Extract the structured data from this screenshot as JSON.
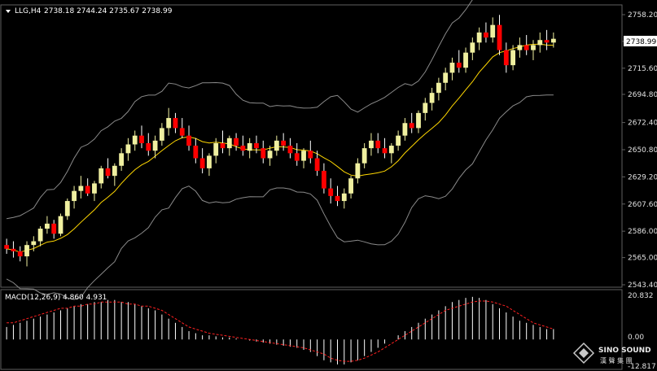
{
  "header": {
    "symbol": "LLG,H4",
    "ohlc": "2738.18 2744.24 2735.67 2738.99"
  },
  "current_price": "2738.99",
  "macd_header": {
    "label": "MACD(12,26,9)",
    "values": "4.860 4.931"
  },
  "macd_axis": {
    "top": "20.832",
    "zero": "0.00",
    "bottom": "-12.817"
  },
  "watermark": {
    "brand": "SINO SOUND",
    "cn": "漢 聲 集 團"
  },
  "colors": {
    "background": "#000000",
    "bull": "#f0f0a0",
    "bear": "#ff0000",
    "bands": "#8a8a8a",
    "ma": "#ffd700",
    "signal": "#ff2020",
    "hist": "#ffffff",
    "grid": "#606060"
  },
  "chart_data": {
    "type": "line",
    "price_ticks": [
      "2758.20",
      "2736.99",
      "2715.60",
      "2694.80",
      "2672.40",
      "2650.80",
      "2629.20",
      "2607.60",
      "2586.00",
      "2565.00",
      "2543.40"
    ],
    "price_range": [
      2543.4,
      2758.2
    ],
    "macd_range": [
      -12.817,
      20.832
    ],
    "candles": [
      [
        2575,
        2580,
        2568,
        2572
      ],
      [
        2572,
        2578,
        2565,
        2570
      ],
      [
        2570,
        2574,
        2562,
        2566
      ],
      [
        2566,
        2578,
        2558,
        2575
      ],
      [
        2575,
        2582,
        2570,
        2578
      ],
      [
        2578,
        2590,
        2574,
        2588
      ],
      [
        2588,
        2598,
        2584,
        2592
      ],
      [
        2592,
        2595,
        2580,
        2584
      ],
      [
        2584,
        2600,
        2582,
        2598
      ],
      [
        2598,
        2612,
        2595,
        2610
      ],
      [
        2610,
        2622,
        2604,
        2618
      ],
      [
        2618,
        2630,
        2612,
        2622
      ],
      [
        2622,
        2628,
        2614,
        2616
      ],
      [
        2616,
        2626,
        2610,
        2624
      ],
      [
        2624,
        2638,
        2620,
        2636
      ],
      [
        2636,
        2644,
        2628,
        2630
      ],
      [
        2630,
        2640,
        2622,
        2638
      ],
      [
        2638,
        2652,
        2634,
        2648
      ],
      [
        2648,
        2660,
        2642,
        2655
      ],
      [
        2655,
        2666,
        2650,
        2662
      ],
      [
        2662,
        2670,
        2652,
        2656
      ],
      [
        2656,
        2664,
        2646,
        2650
      ],
      [
        2650,
        2662,
        2644,
        2658
      ],
      [
        2658,
        2672,
        2654,
        2668
      ],
      [
        2668,
        2684,
        2662,
        2676
      ],
      [
        2676,
        2680,
        2664,
        2668
      ],
      [
        2668,
        2676,
        2660,
        2662
      ],
      [
        2662,
        2670,
        2650,
        2654
      ],
      [
        2654,
        2660,
        2640,
        2644
      ],
      [
        2644,
        2652,
        2632,
        2636
      ],
      [
        2636,
        2648,
        2630,
        2646
      ],
      [
        2646,
        2660,
        2640,
        2656
      ],
      [
        2656,
        2666,
        2648,
        2652
      ],
      [
        2652,
        2662,
        2646,
        2660
      ],
      [
        2660,
        2664,
        2650,
        2654
      ],
      [
        2654,
        2662,
        2646,
        2650
      ],
      [
        2650,
        2660,
        2644,
        2656
      ],
      [
        2656,
        2662,
        2648,
        2652
      ],
      [
        2652,
        2658,
        2640,
        2644
      ],
      [
        2644,
        2654,
        2638,
        2650
      ],
      [
        2650,
        2662,
        2646,
        2658
      ],
      [
        2658,
        2664,
        2650,
        2654
      ],
      [
        2654,
        2660,
        2644,
        2648
      ],
      [
        2648,
        2656,
        2638,
        2642
      ],
      [
        2642,
        2652,
        2636,
        2650
      ],
      [
        2650,
        2658,
        2640,
        2644
      ],
      [
        2644,
        2650,
        2630,
        2634
      ],
      [
        2634,
        2640,
        2616,
        2620
      ],
      [
        2620,
        2628,
        2608,
        2614
      ],
      [
        2614,
        2622,
        2606,
        2610
      ],
      [
        2610,
        2620,
        2604,
        2616
      ],
      [
        2616,
        2630,
        2612,
        2628
      ],
      [
        2628,
        2644,
        2624,
        2640
      ],
      [
        2640,
        2656,
        2636,
        2652
      ],
      [
        2652,
        2664,
        2646,
        2658
      ],
      [
        2658,
        2664,
        2648,
        2652
      ],
      [
        2652,
        2660,
        2644,
        2648
      ],
      [
        2648,
        2656,
        2640,
        2654
      ],
      [
        2654,
        2666,
        2650,
        2662
      ],
      [
        2662,
        2676,
        2658,
        2672
      ],
      [
        2672,
        2680,
        2664,
        2668
      ],
      [
        2668,
        2682,
        2664,
        2680
      ],
      [
        2680,
        2692,
        2674,
        2688
      ],
      [
        2688,
        2700,
        2682,
        2696
      ],
      [
        2696,
        2708,
        2690,
        2704
      ],
      [
        2704,
        2716,
        2698,
        2712
      ],
      [
        2712,
        2724,
        2706,
        2720
      ],
      [
        2720,
        2730,
        2712,
        2716
      ],
      [
        2716,
        2732,
        2712,
        2728
      ],
      [
        2728,
        2740,
        2722,
        2736
      ],
      [
        2736,
        2748,
        2730,
        2744
      ],
      [
        2744,
        2752,
        2736,
        2740
      ],
      [
        2740,
        2756,
        2736,
        2750
      ],
      [
        2750,
        2758,
        2726,
        2730
      ],
      [
        2730,
        2736,
        2712,
        2718
      ],
      [
        2718,
        2734,
        2714,
        2730
      ],
      [
        2730,
        2740,
        2724,
        2734
      ],
      [
        2734,
        2742,
        2726,
        2730
      ],
      [
        2730,
        2738,
        2722,
        2734
      ],
      [
        2734,
        2744,
        2728,
        2738
      ],
      [
        2738,
        2746,
        2730,
        2736
      ],
      [
        2736,
        2744,
        2732,
        2739
      ]
    ],
    "macd_hist": [
      6,
      7,
      8,
      9,
      10,
      11,
      12,
      13,
      14,
      15,
      16,
      17,
      17,
      18,
      18,
      19,
      19,
      18,
      18,
      17,
      16,
      15,
      14,
      12,
      10,
      8,
      6,
      4,
      3,
      2,
      2,
      1.5,
      1,
      1,
      0.5,
      0,
      -0.5,
      -1,
      -1.5,
      -2,
      -2.5,
      -3,
      -3.5,
      -4,
      -5,
      -6,
      -8,
      -10,
      -11,
      -12,
      -12,
      -11,
      -10,
      -8,
      -6,
      -4,
      -2,
      0,
      2,
      4,
      6,
      8,
      10,
      12,
      14,
      16,
      18,
      19,
      20,
      20.5,
      20,
      19,
      17,
      15,
      13,
      11,
      9,
      8,
      7,
      6,
      5,
      5
    ],
    "macd_signal": [
      8,
      8,
      9,
      10,
      11,
      12,
      13,
      14,
      15,
      15,
      16,
      16,
      17,
      17,
      18,
      18,
      18,
      18,
      17,
      17,
      16,
      16,
      15,
      14,
      12,
      10,
      8,
      6,
      5,
      4,
      3,
      2.5,
      2,
      1.5,
      1,
      0.5,
      0,
      -0.5,
      -1,
      -1.5,
      -2,
      -2.5,
      -3,
      -3.5,
      -4,
      -5,
      -6,
      -7,
      -9,
      -10,
      -10.5,
      -10.5,
      -10,
      -9,
      -7.5,
      -6,
      -4,
      -2,
      0,
      2,
      4,
      6,
      8,
      10,
      12,
      14,
      15,
      16,
      17,
      18,
      18.5,
      18.5,
      18,
      17,
      16,
      14,
      12,
      10,
      8,
      7,
      6,
      5
    ]
  }
}
